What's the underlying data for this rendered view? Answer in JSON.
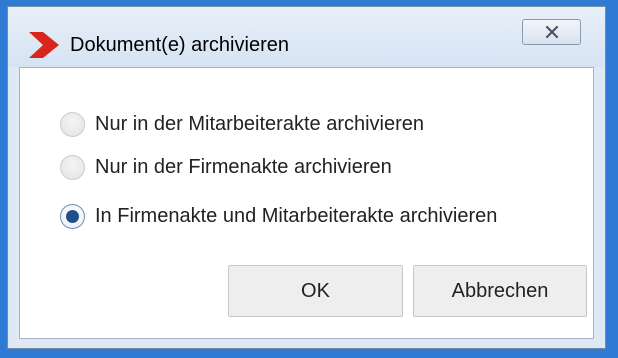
{
  "dialog": {
    "title": "Dokument(e) archivieren",
    "close_label": "✕"
  },
  "options": [
    {
      "label": "Nur in der Mitarbeiterakte archivieren",
      "checked": false
    },
    {
      "label": "Nur in der Firmenakte archivieren",
      "checked": false
    },
    {
      "label": "In Firmenakte und Mitarbeiterakte archivieren",
      "checked": true
    }
  ],
  "buttons": {
    "ok_label": "OK",
    "cancel_label": "Abbrechen"
  },
  "colors": {
    "logo_red": "#d8261c",
    "selected_dot": "#1f4f87",
    "frame_blue": "#2f7bd4"
  },
  "icons": {
    "logo": "red-chevron-logo",
    "close": "close-x-icon"
  }
}
